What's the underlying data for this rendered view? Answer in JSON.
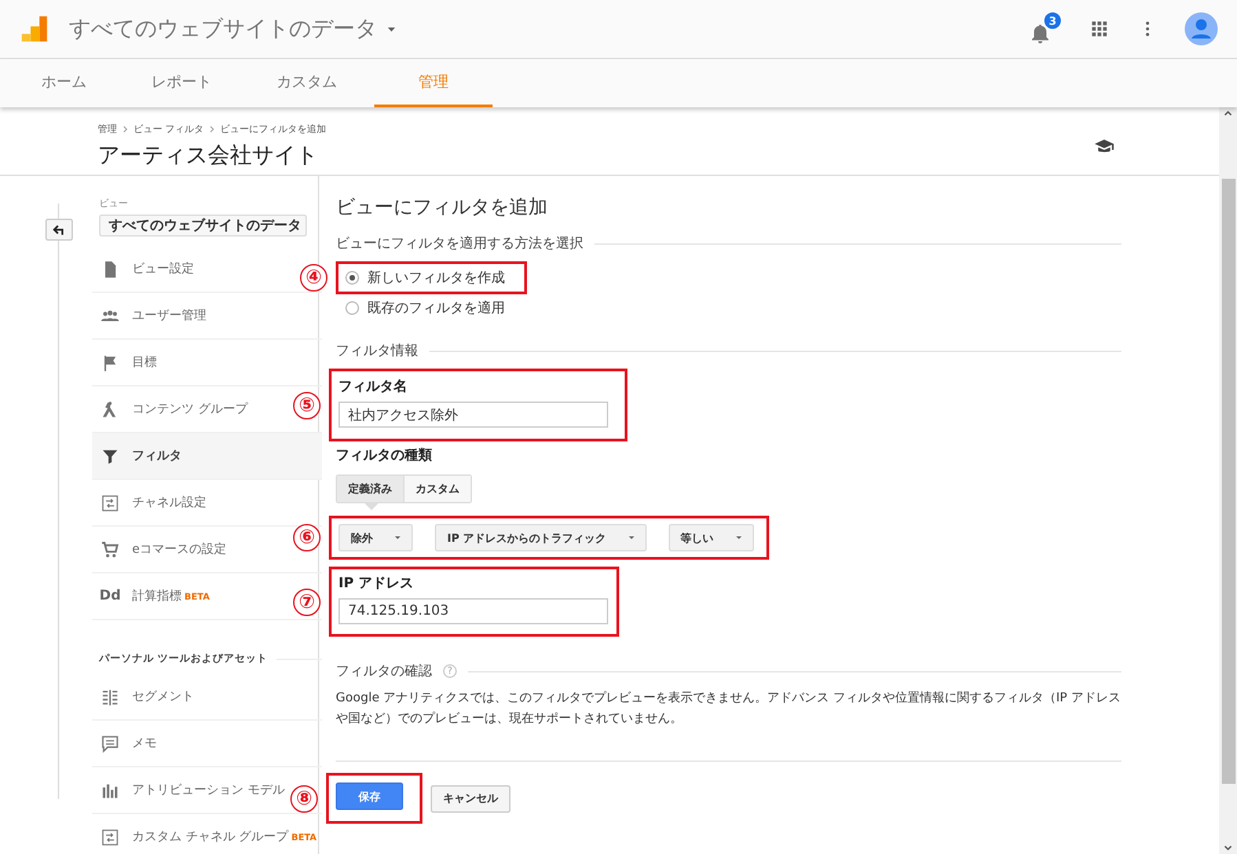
{
  "app_bar": {
    "title": "すべてのウェブサイトのデータ",
    "notification_count": "3"
  },
  "tabs": [
    {
      "label": "ホーム",
      "selected": false
    },
    {
      "label": "レポート",
      "selected": false
    },
    {
      "label": "カスタム",
      "selected": false
    },
    {
      "label": "管理",
      "selected": true
    }
  ],
  "breadcrumb": [
    "管理",
    "ビュー フィルタ",
    "ビューにフィルタを追加"
  ],
  "page_title": "アーティス会社サイト",
  "sidebar": {
    "view_label": "ビュー",
    "view_select": "すべてのウェブサイトのデータ",
    "items": [
      {
        "label": "ビュー設定",
        "kind": "document",
        "selected": false
      },
      {
        "label": "ユーザー管理",
        "kind": "users",
        "selected": false
      },
      {
        "label": "目標",
        "kind": "flag",
        "selected": false
      },
      {
        "label": "コンテンツ グループ",
        "kind": "split",
        "selected": false
      },
      {
        "label": "フィルタ",
        "kind": "filter",
        "selected": true
      },
      {
        "label": "チャネル設定",
        "kind": "channel",
        "selected": false
      },
      {
        "label": "eコマースの設定",
        "kind": "cart",
        "selected": false
      },
      {
        "label": "計算指標",
        "kind": "text",
        "icon_text": "Dd",
        "badge": "BETA",
        "selected": false
      }
    ],
    "section_title": "パーソナル ツールおよびアセット",
    "personal_items": [
      {
        "label": "セグメント",
        "kind": "segment",
        "selected": false
      },
      {
        "label": "メモ",
        "kind": "memo",
        "selected": false
      },
      {
        "label": "アトリビューション モデル",
        "kind": "bars",
        "selected": false
      },
      {
        "label": "カスタム チャネル グループ",
        "kind": "channel",
        "badge": "BETA",
        "selected": false
      }
    ]
  },
  "form": {
    "title": "ビューにフィルタを追加",
    "method_heading": "ビューにフィルタを適用する方法を選択",
    "methods": [
      {
        "label": "新しいフィルタを作成",
        "selected": true,
        "callout": "④"
      },
      {
        "label": "既存のフィルタを適用",
        "selected": false
      }
    ],
    "info_heading": "フィルタ情報",
    "name_label": "フィルタ名",
    "name_value": "社内アクセス除外",
    "name_callout": "⑤",
    "type_label": "フィルタの種類",
    "type_tabs": [
      {
        "label": "定義済み",
        "selected": true
      },
      {
        "label": "カスタム",
        "selected": false
      }
    ],
    "dropdowns": [
      "除外",
      "IP アドレスからのトラフィック",
      "等しい"
    ],
    "dropdowns_callout": "⑥",
    "ip_label": "IP アドレス",
    "ip_value": "74.125.19.103",
    "ip_callout": "⑦",
    "verify_heading": "フィルタの確認",
    "verify_help": "?",
    "verify_text": "Google アナリティクスでは、このフィルタでプレビューを表示できません。アドバンス フィルタや位置情報に関するフィルタ（IP アドレスや国など）でのプレビューは、現在サポートされていません。",
    "buttons": [
      {
        "label": "保存",
        "kind": "primary",
        "callout": "⑧"
      },
      {
        "label": "キャンセル",
        "kind": "secondary"
      }
    ]
  }
}
